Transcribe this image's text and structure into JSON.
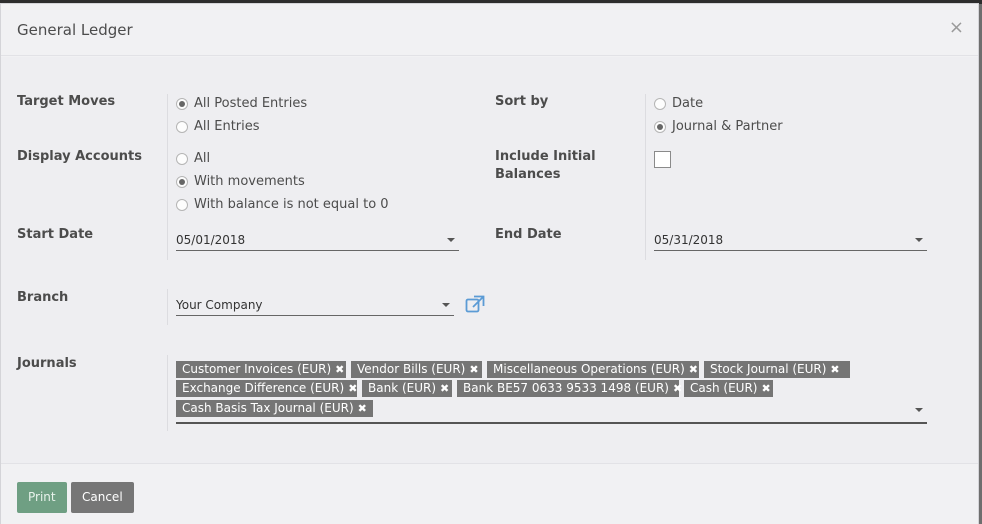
{
  "dialog": {
    "title": "General Ledger",
    "close_glyph": "×"
  },
  "target_moves": {
    "label": "Target Moves",
    "options": [
      {
        "label": "All Posted Entries",
        "selected": true
      },
      {
        "label": "All Entries",
        "selected": false
      }
    ]
  },
  "sort_by": {
    "label": "Sort by",
    "options": [
      {
        "label": "Date",
        "selected": false
      },
      {
        "label": "Journal & Partner",
        "selected": true
      }
    ]
  },
  "display_accounts": {
    "label": "Display Accounts",
    "options": [
      {
        "label": "All",
        "selected": false
      },
      {
        "label": "With movements",
        "selected": true
      },
      {
        "label": "With balance is not equal to 0",
        "selected": false
      }
    ]
  },
  "include_initial_balances": {
    "label_line1": "Include Initial",
    "label_line2": "Balances",
    "checked": false
  },
  "start_date": {
    "label": "Start Date",
    "value": "05/01/2018"
  },
  "end_date": {
    "label": "End Date",
    "value": "05/31/2018"
  },
  "branch": {
    "label": "Branch",
    "value": "Your Company",
    "link_icon": "external-link-icon"
  },
  "journals": {
    "label": "Journals",
    "tags": [
      "Customer Invoices (EUR)",
      "Vendor Bills (EUR)",
      "Miscellaneous Operations (EUR)",
      "Stock Journal (EUR)",
      "Exchange Difference (EUR)",
      "Bank (EUR)",
      "Bank BE57 0633 9533 1498 (EUR)",
      "Cash (EUR)",
      "Cash Basis Tax Journal (EUR)"
    ],
    "remove_glyph": "✖"
  },
  "footer": {
    "print_label": "Print",
    "cancel_label": "Cancel"
  },
  "colors": {
    "primary": "#6f9f83",
    "secondary": "#767676",
    "tag": "#757575",
    "link": "#5b9bd5"
  }
}
